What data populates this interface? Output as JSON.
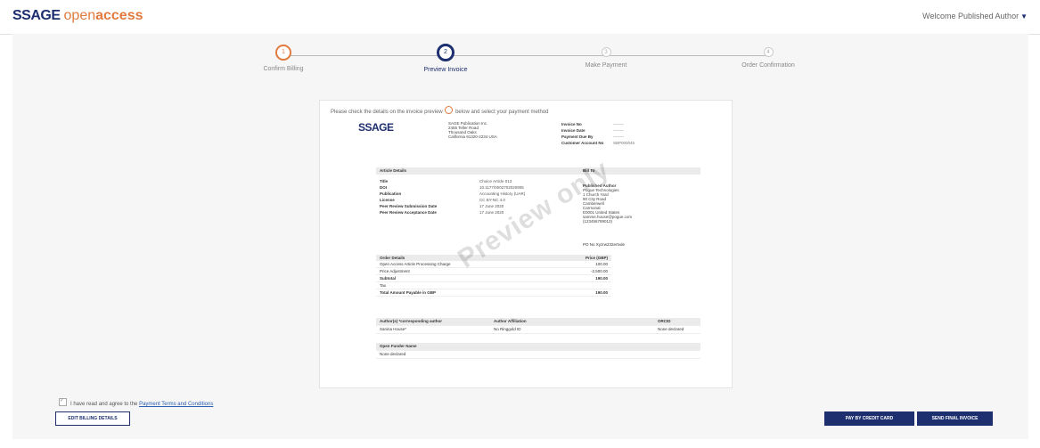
{
  "header": {
    "logo_sage": "SSAGE",
    "logo_open": "open",
    "logo_access": "access",
    "welcome": "Welcome Published Author"
  },
  "steps": [
    {
      "num": "1",
      "label": "Confirm Billing"
    },
    {
      "num": "2",
      "label": "Preview Invoice"
    },
    {
      "num": "3",
      "label": "Make Payment"
    },
    {
      "num": "4",
      "label": "Order Confirmation"
    }
  ],
  "intro": {
    "before": "Please check the details on the invoice preview",
    "after": "below and select your payment method"
  },
  "invoice": {
    "logo": "SSAGE",
    "address": [
      "SAGE Publication Inc.",
      "2455 Teller Road",
      "Thousand Oaks",
      "California 91320-2234 USA"
    ],
    "meta": [
      {
        "k": "Invoice No",
        "v": "--------"
      },
      {
        "k": "Invoice Date",
        "v": "--------"
      },
      {
        "k": "Payment Due By",
        "v": "--------"
      },
      {
        "k": "Customer Account No",
        "v": "SBP000045"
      }
    ],
    "article_head": "Article Details",
    "article": [
      {
        "k": "Title",
        "v": "Choice Article 013"
      },
      {
        "k": "DOI",
        "v": "10.1177/0002702020905"
      },
      {
        "k": "Publication",
        "v": "Accounting History (UAR)"
      },
      {
        "k": "License",
        "v": "CC BY-NC 4.0"
      },
      {
        "k": "Peer Review Submission Date",
        "v": "17 June 2020"
      },
      {
        "k": "Peer Review Acceptance Date",
        "v": "17 June 2020"
      }
    ],
    "billto_head": "Bill To",
    "billto": [
      "Published Author",
      "Pogue Technologies",
      "1 Church Yard",
      "90 City Road",
      "Camberwell",
      "Carrsonal",
      "E0001 United States",
      "samme.house@pogue.com",
      "(123456789012)"
    ],
    "po": "PO No Xyzrw232ertvde",
    "order_head": "Order Details",
    "price_head": "Price (GBP)",
    "order": [
      {
        "k": "Open Access Article Processing Charge",
        "v": "100.00",
        "bold": false
      },
      {
        "k": "Price Adjustment",
        "v": "-2,500.00",
        "bold": false
      },
      {
        "k": "Subtotal",
        "v": "190.00",
        "bold": true
      },
      {
        "k": "Tax",
        "v": "",
        "bold": false
      },
      {
        "k": "Total Amount Payable in GBP",
        "v": "190.00",
        "bold": true
      }
    ],
    "authors_head": [
      "Author(s) *corresponding author",
      "Author Affiliation",
      "ORCID"
    ],
    "authors_row": [
      "Sanina House*",
      "No Ringgold ID",
      "None declared"
    ],
    "funder_head": "Open Funder Name",
    "funder_value": "None declared",
    "watermark": "Preview only"
  },
  "footer": {
    "agree_text": "I have read and agree to the",
    "agree_link": "Payment Terms and Conditions",
    "edit_button": "EDIT BILLING DETAILS",
    "pay_button": "PAY BY CREDIT CARD",
    "send_button": "SEND FINAL INVOICE"
  },
  "colors": {
    "brand_navy": "#1d2f6f",
    "accent_orange": "#e07a3e"
  }
}
